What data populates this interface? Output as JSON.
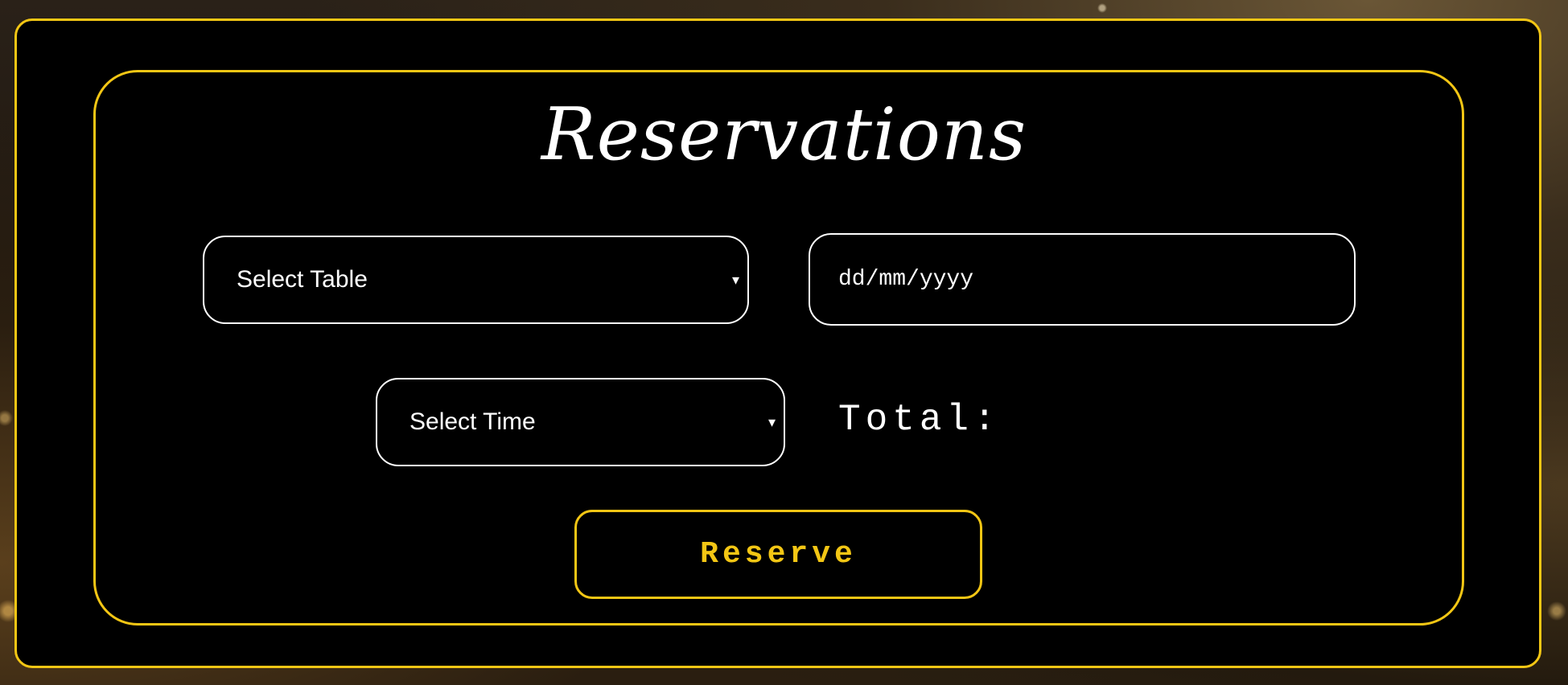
{
  "reservation_form": {
    "title": "Reservations",
    "table_select": {
      "selected_value": "Select Table",
      "arrow": "▾"
    },
    "date_input": {
      "placeholder": "dd/mm/yyyy"
    },
    "time_select": {
      "selected_value": "Select Time",
      "arrow": "▾"
    },
    "total_label": "Total:",
    "reserve_label": "Reserve"
  },
  "colors": {
    "accent": "#f3c614",
    "panel_background": "#000000",
    "text": "#ffffff"
  }
}
